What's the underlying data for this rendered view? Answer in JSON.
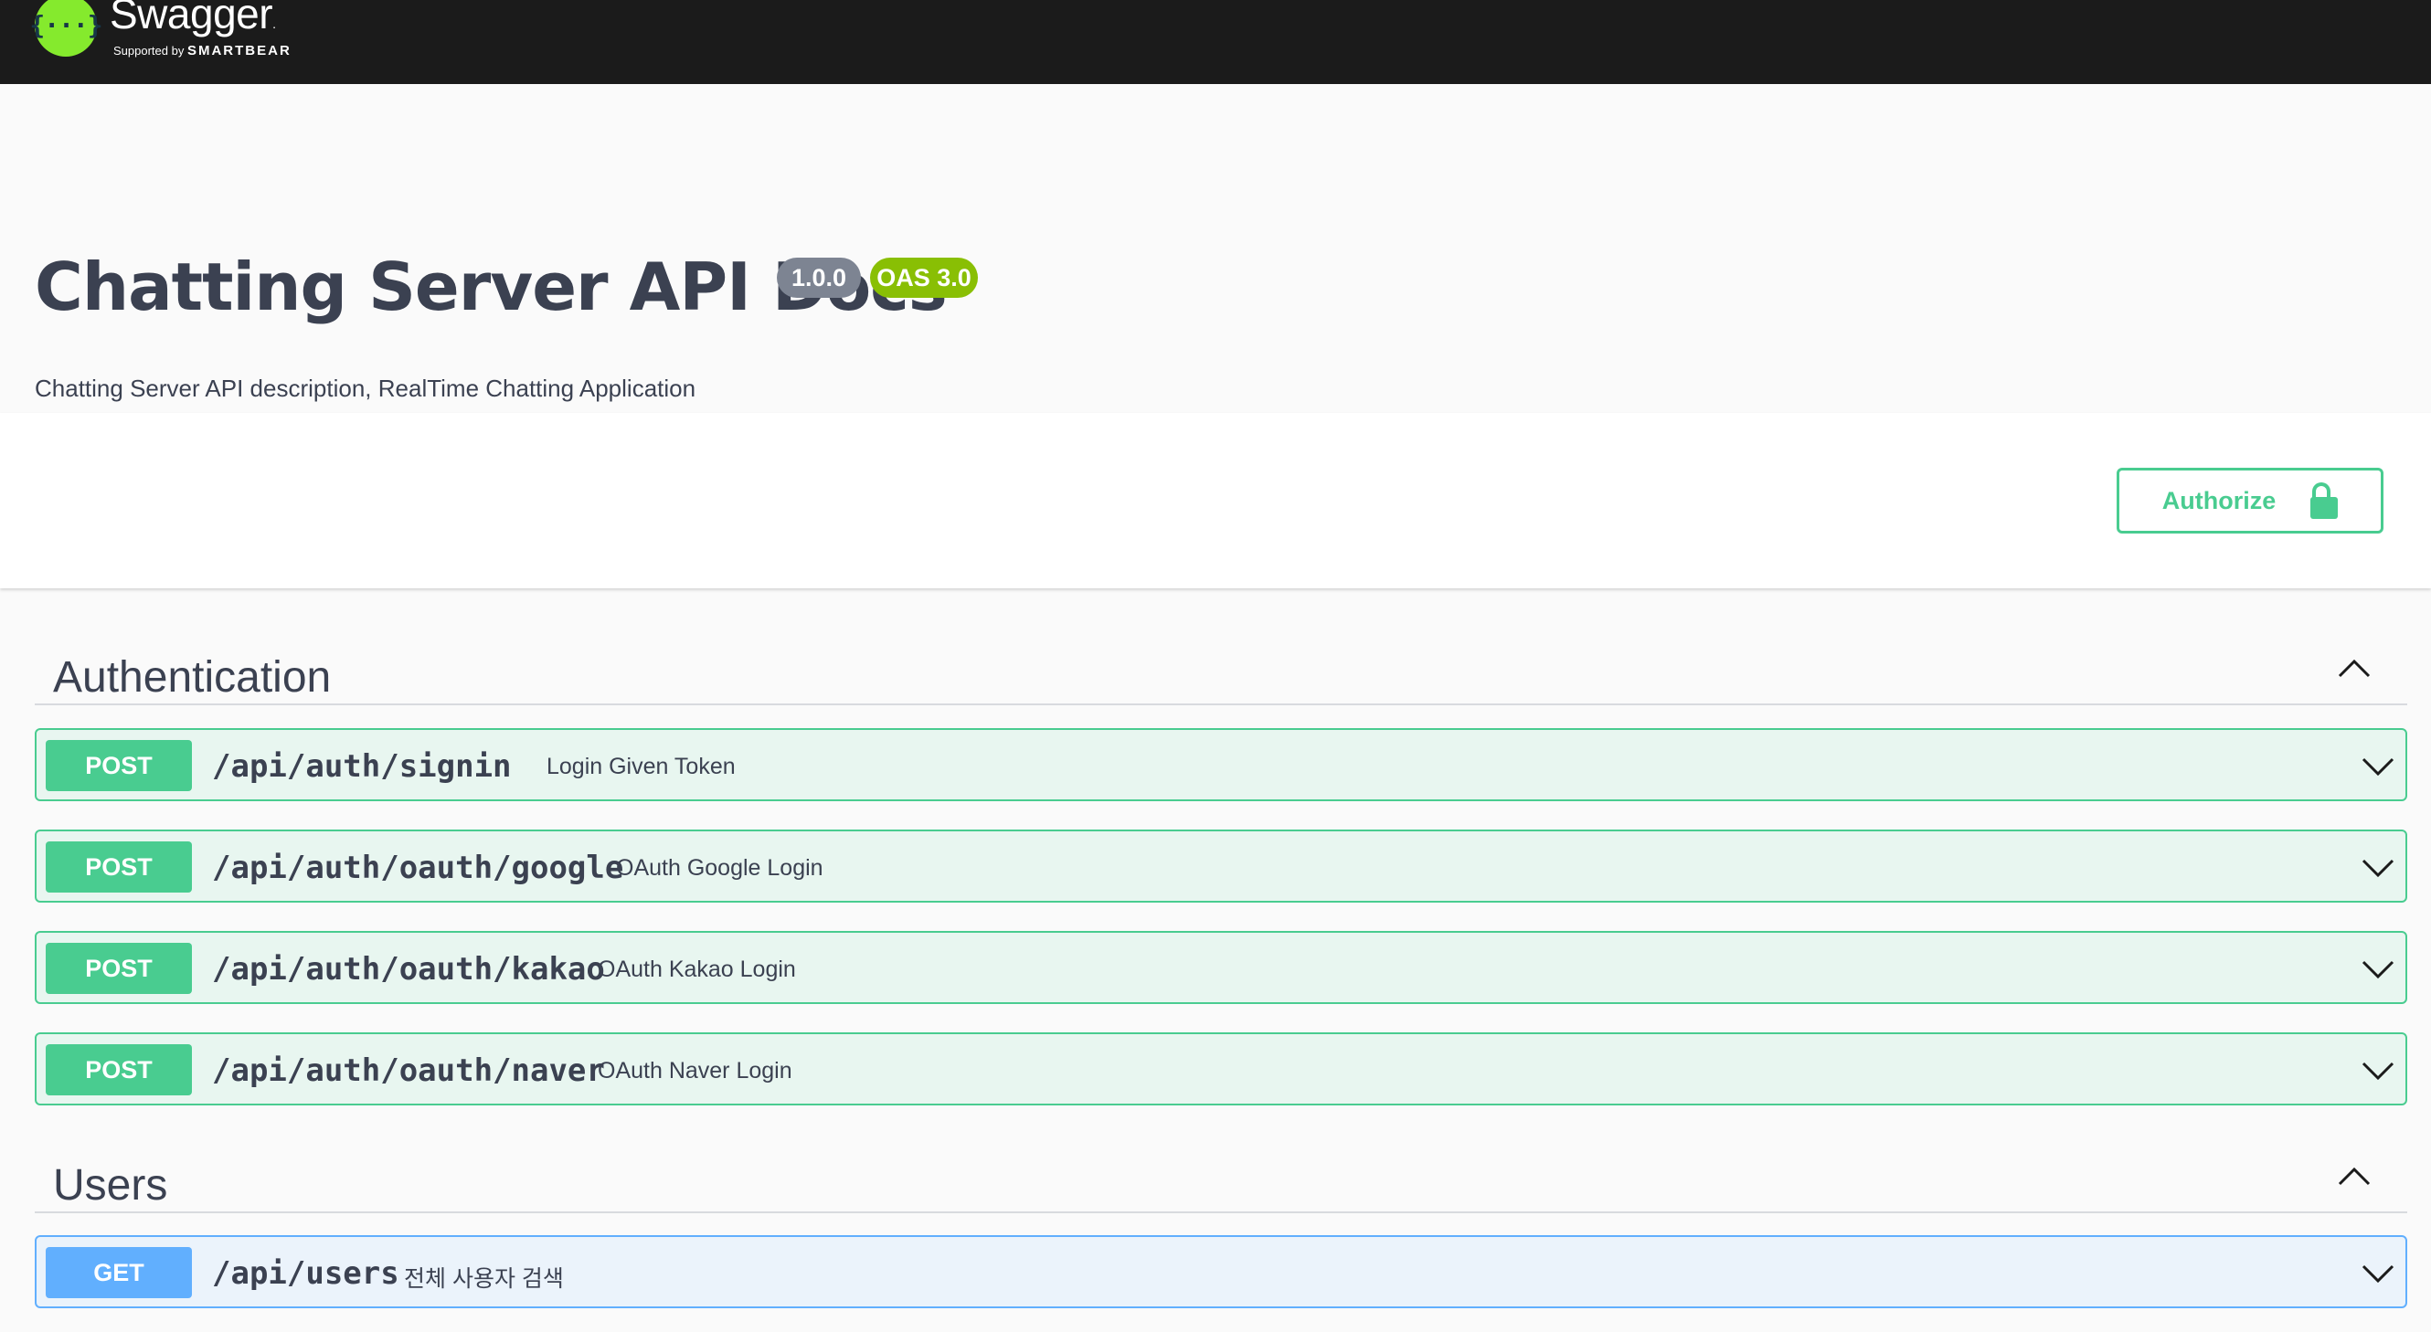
{
  "topbar": {
    "logo_mark": "{···}",
    "logo_name": "Swagger",
    "logo_tm": ".",
    "logo_sub_prefix": "Supported by",
    "logo_sub_brand": "SMARTBEAR"
  },
  "info": {
    "title": "Chatting Server API Docs",
    "version_badge": "1.0.0",
    "oas_badge": "OAS 3.0",
    "description": "Chatting Server API description, RealTime Chatting Application"
  },
  "authorize": {
    "label": "Authorize",
    "icon": "lock-icon"
  },
  "sections": [
    {
      "name": "Authentication",
      "expanded": true,
      "operations": [
        {
          "method": "POST",
          "path": "/api/auth/signin",
          "summary": "Login Given Token"
        },
        {
          "method": "POST",
          "path": "/api/auth/oauth/google",
          "summary": "OAuth Google Login"
        },
        {
          "method": "POST",
          "path": "/api/auth/oauth/kakao",
          "summary": "OAuth Kakao Login"
        },
        {
          "method": "POST",
          "path": "/api/auth/oauth/naver",
          "summary": "OAuth Naver Login"
        }
      ]
    },
    {
      "name": "Users",
      "expanded": true,
      "operations": [
        {
          "method": "GET",
          "path": "/api/users",
          "summary": "전체 사용자 검색"
        }
      ]
    }
  ],
  "colors": {
    "topbar": "#1b1b1b",
    "post": "#49cc90",
    "get": "#61affe",
    "version_badge": "#7d8492",
    "oas_badge": "#89bf04",
    "logo_green": "#85ea2d"
  }
}
